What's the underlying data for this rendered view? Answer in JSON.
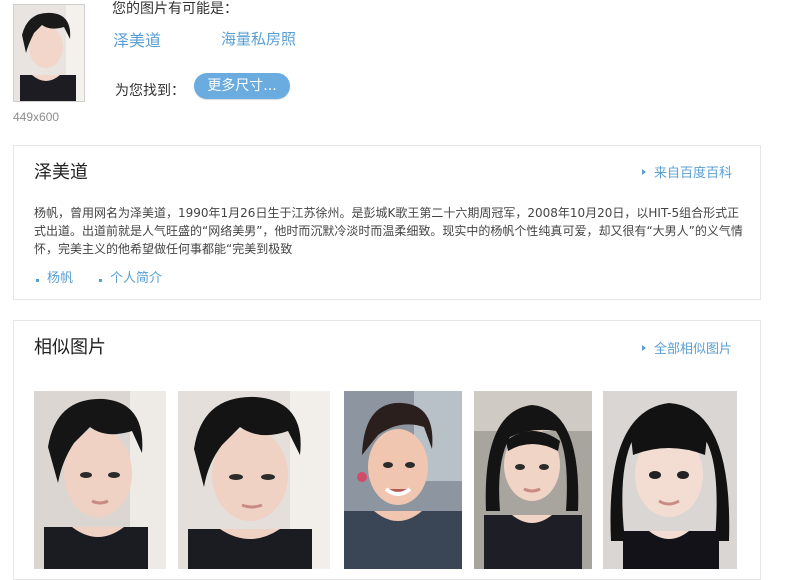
{
  "query": {
    "size_label": "449x600",
    "guess_title": "您的图片有可能是：",
    "guesses": [
      "泽美道",
      "海量私房照"
    ],
    "found_label": "为您找到：",
    "more_sizes_button": "更多尺寸..."
  },
  "baike": {
    "title": "泽美道",
    "source_link": "来自百度百科",
    "description": "杨帆，曾用网名为泽美道，1990年1月26日生于江苏徐州。是彭城K歌王第二十六期周冠军，2008年10月20日，以HIT-5组合形式正式出道。出道前就是人气旺盛的“网络美男”，他时而沉默冷淡时而温柔细致。现实中的杨帆个性纯真可爱，却又很有“大男人”的义气情怀，完美主义的他希望做任何事都能“完美到极致",
    "links": [
      "杨帆",
      "个人简介"
    ]
  },
  "similar": {
    "title": "相似图片",
    "all_link": "全部相似图片",
    "images": [
      {
        "desc": "dark-haired boy portrait"
      },
      {
        "desc": "dark-haired boy portrait"
      },
      {
        "desc": "girl smiling portrait"
      },
      {
        "desc": "girl in car portrait"
      },
      {
        "desc": "girl with bangs portrait"
      }
    ]
  },
  "colors": {
    "link": "#5a9fd4",
    "button": "#6aace0",
    "border": "#e6e6e6"
  }
}
